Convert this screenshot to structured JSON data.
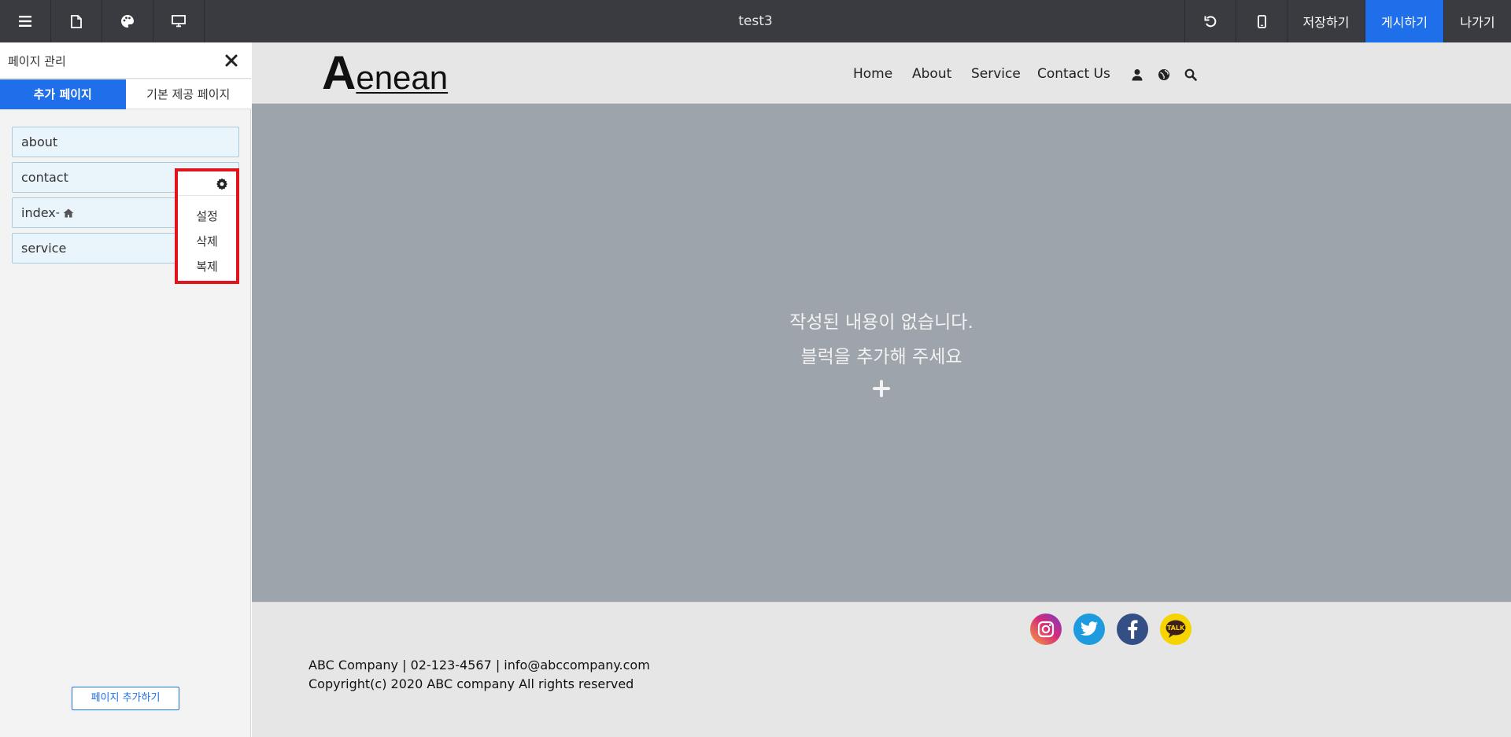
{
  "topbar": {
    "title": "test3",
    "menu_icon": "hamburger-icon",
    "page_icon": "document-icon",
    "theme_icon": "palette-icon",
    "desktop_icon": "monitor-icon",
    "undo_icon": "undo-icon",
    "mobile_icon": "mobile-icon",
    "save_label": "저장하기",
    "publish_label": "게시하기",
    "exit_label": "나가기"
  },
  "panel": {
    "title": "페이지 관리",
    "tabs": [
      {
        "label": "추가 페이지",
        "active": true
      },
      {
        "label": "기본 제공 페이지",
        "active": false
      }
    ],
    "pages": [
      {
        "name": "about"
      },
      {
        "name": "contact"
      },
      {
        "name": "index",
        "suffix": " -",
        "home": true
      },
      {
        "name": "service"
      }
    ],
    "context_menu": {
      "items": [
        "설정",
        "삭제",
        "복제"
      ]
    },
    "add_button": "페이지 추가하기"
  },
  "site": {
    "logo_first": "A",
    "logo_rest": "enean",
    "nav": [
      "Home",
      "About",
      "Service",
      "Contact Us"
    ],
    "nav_icons": [
      "user-icon",
      "globe-icon",
      "search-icon"
    ],
    "empty_line1": "작성된 내용이 없습니다.",
    "empty_line2": "블럭을 추가해 주세요",
    "footer_line1": "ABC Company | 02-123-4567 | info@abccompany.com",
    "footer_line2": "Copyright(c) 2020 ABC company All rights reserved",
    "social": [
      "instagram-icon",
      "twitter-icon",
      "facebook-icon",
      "kakaotalk-icon"
    ],
    "talk_label": "TALK"
  },
  "colors": {
    "accent": "#1f6feb",
    "topbar_bg": "#393b40",
    "highlight": "#e0141a",
    "content_bg": "#9ea4ab"
  }
}
